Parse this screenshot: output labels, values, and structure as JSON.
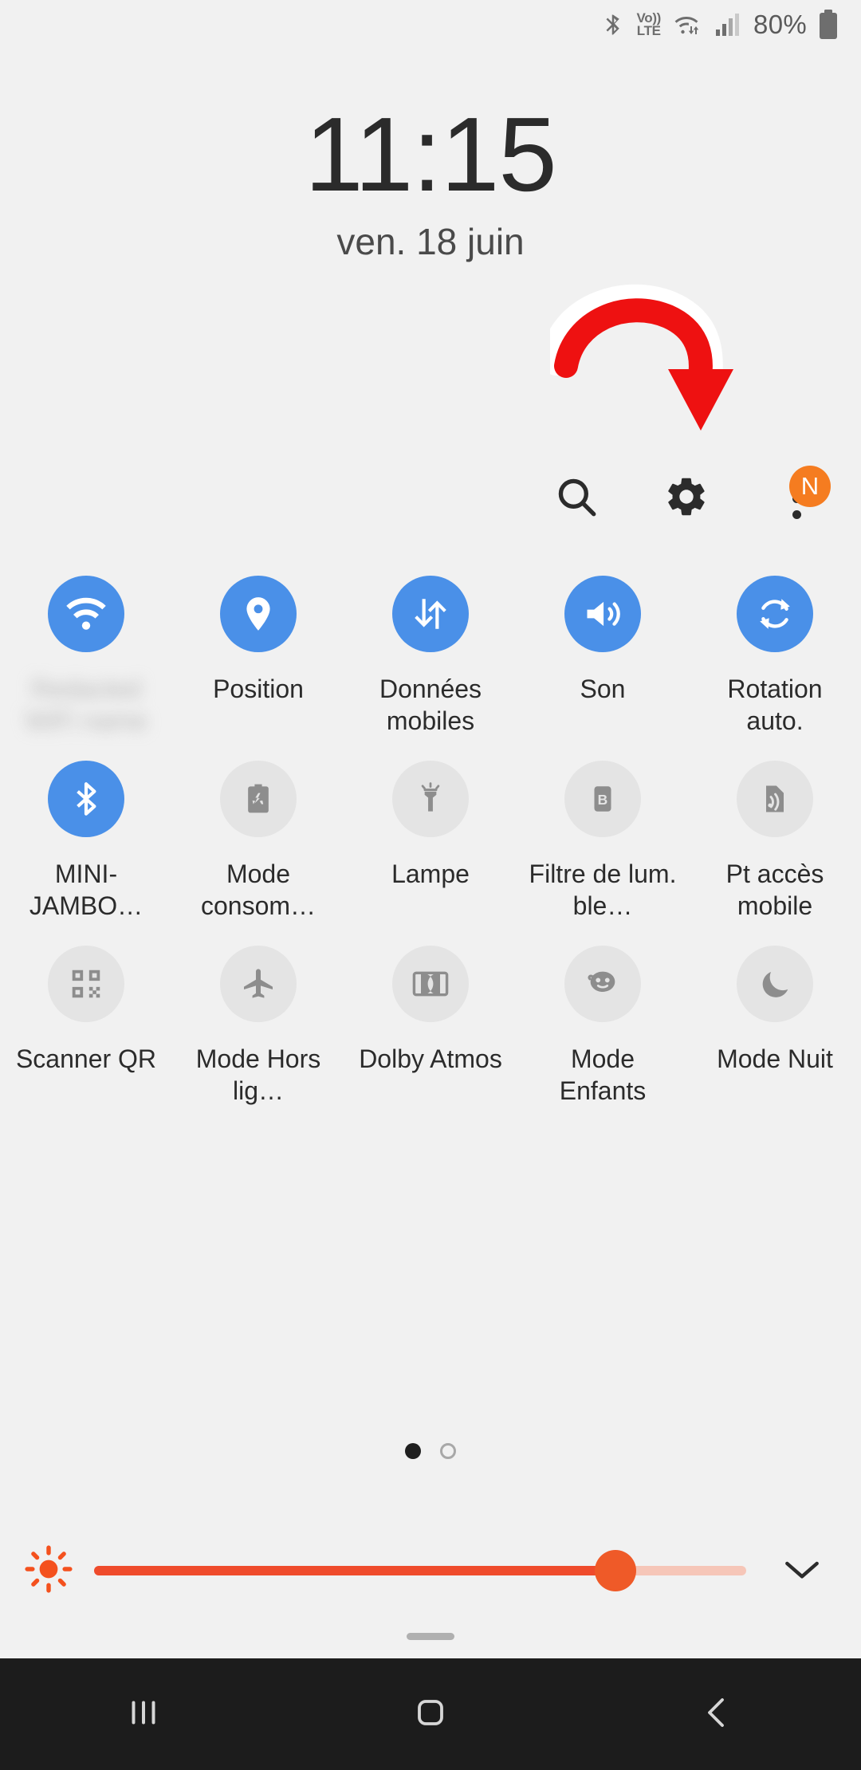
{
  "status_bar": {
    "bluetooth_icon": "bluetooth-icon",
    "volte_line1": "Vo))",
    "volte_line2": "LTE",
    "wifi_icon": "wifi-data-icon",
    "signal_icon": "signal-bars-icon",
    "battery_percent": "80%",
    "battery_icon": "battery-icon"
  },
  "clock": {
    "time": "11:15",
    "date": "ven. 18 juin"
  },
  "header": {
    "search_icon": "search-icon",
    "settings_icon": "gear-icon",
    "more_icon": "kebab-menu-icon",
    "badge_label": "N"
  },
  "annotation": {
    "arrow_color": "#ee1111",
    "points_to": "gear-icon"
  },
  "tiles": [
    [
      {
        "label": "",
        "icon": "wifi-icon",
        "state": "on",
        "blurred": true
      },
      {
        "label": "Position",
        "icon": "location-pin-icon",
        "state": "on",
        "blurred": false
      },
      {
        "label": "Données mobiles",
        "icon": "data-arrows-icon",
        "state": "on",
        "blurred": false
      },
      {
        "label": "Son",
        "icon": "speaker-icon",
        "state": "on",
        "blurred": false
      },
      {
        "label": "Rotation auto.",
        "icon": "rotate-icon",
        "state": "on",
        "blurred": false
      }
    ],
    [
      {
        "label": "MINI-JAMBO…",
        "icon": "bluetooth-icon",
        "state": "on",
        "blurred": false
      },
      {
        "label": "Mode consom…",
        "icon": "battery-saver-icon",
        "state": "off",
        "blurred": false
      },
      {
        "label": "Lampe",
        "icon": "flashlight-icon",
        "state": "off",
        "blurred": false
      },
      {
        "label": "Filtre de lum. ble…",
        "icon": "blue-light-filter-icon",
        "state": "off",
        "blurred": false
      },
      {
        "label": "Pt accès mobile",
        "icon": "hotspot-icon",
        "state": "off",
        "blurred": false
      }
    ],
    [
      {
        "label": "Scanner QR",
        "icon": "qr-code-icon",
        "state": "off",
        "blurred": false
      },
      {
        "label": "Mode Hors lig…",
        "icon": "airplane-icon",
        "state": "off",
        "blurred": false
      },
      {
        "label": "Dolby Atmos",
        "icon": "dolby-icon",
        "state": "off",
        "blurred": false
      },
      {
        "label": "Mode Enfants",
        "icon": "kids-mode-icon",
        "state": "off",
        "blurred": false
      },
      {
        "label": "Mode Nuit",
        "icon": "moon-icon",
        "state": "off",
        "blurred": false
      }
    ]
  ],
  "pager": {
    "total": 2,
    "active_index": 0
  },
  "brightness": {
    "icon": "brightness-sun-icon",
    "value_percent": 80,
    "expand_icon": "chevron-down-icon",
    "fill_color": "#ef4b2c",
    "thumb_color": "#ef5a28"
  },
  "navbar": {
    "recents_icon": "recents-icon",
    "home_icon": "home-icon",
    "back_icon": "back-icon"
  }
}
